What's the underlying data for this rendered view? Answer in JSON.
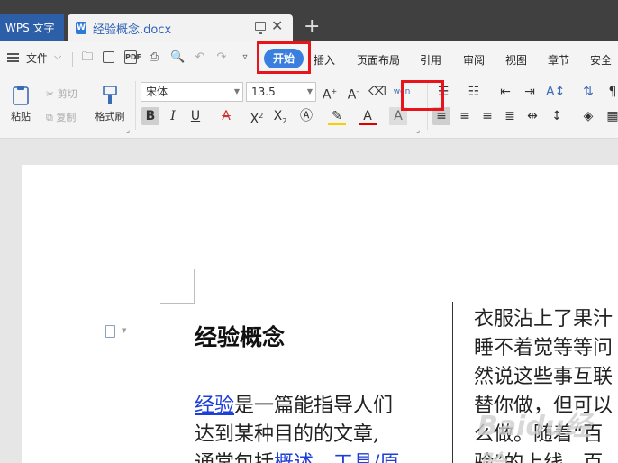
{
  "titlebar": {
    "app_tab": "WPS 文字",
    "doc_tab": "经验概念.docx",
    "new_tab": "+"
  },
  "menu": {
    "file": "文件",
    "active_tab": "开始",
    "tabs": [
      "插入",
      "页面布局",
      "引用",
      "审阅",
      "视图",
      "章节",
      "安全"
    ]
  },
  "toolbar": {
    "paste": "粘贴",
    "cut": "剪切",
    "copy": "复制",
    "format_painter": "格式刷",
    "font_name": "宋体",
    "font_size": "13.5"
  },
  "document": {
    "heading": "经验概念",
    "left_col": {
      "link1": "经验",
      "line1_rest": "是一篇能指导人们",
      "line2": "达到某种目的的文章,",
      "line3_start": "通常包括",
      "link2": "概述、工具/原"
    },
    "right_col": [
      "衣服沾上了果汁",
      "睡不着觉等等问",
      "然说这些事互联",
      "替你做，但可以",
      "么做。随着“百",
      "验”的上线，百"
    ],
    "watermark": "Baidu经验"
  },
  "highlight_color": "#e8141b",
  "accent": "#3a7fe0"
}
